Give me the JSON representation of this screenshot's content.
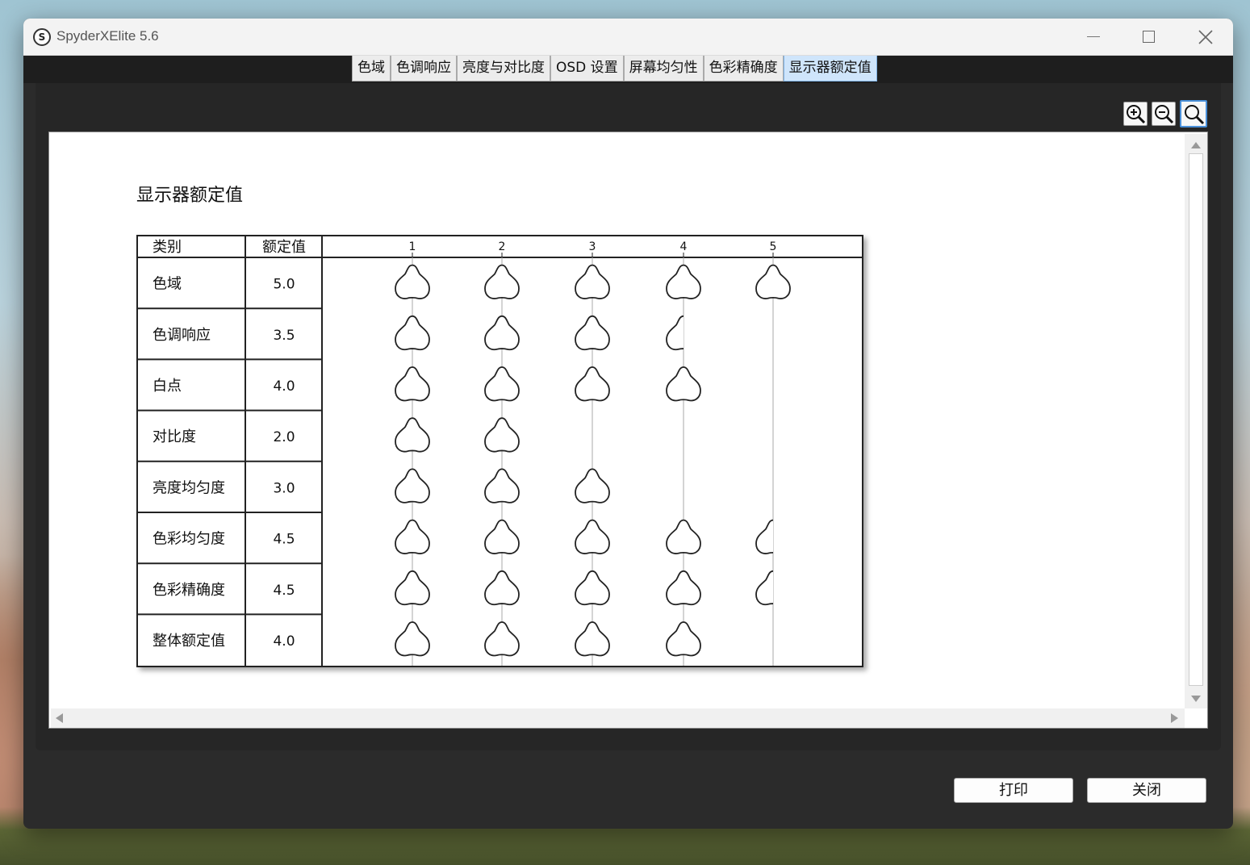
{
  "window": {
    "title": "SpyderXElite 5.6",
    "app_icon_letter": "S"
  },
  "tabs": [
    {
      "label": "色域",
      "active": false
    },
    {
      "label": "色调响应",
      "active": false
    },
    {
      "label": "亮度与对比度",
      "active": false
    },
    {
      "label": "OSD 设置",
      "active": false
    },
    {
      "label": "屏幕均匀性",
      "active": false
    },
    {
      "label": "色彩精确度",
      "active": false
    },
    {
      "label": "显示器额定值",
      "active": true
    }
  ],
  "report": {
    "title": "显示器额定值",
    "header": {
      "category": "类别",
      "rating": "额定值",
      "scale": [
        "1",
        "2",
        "3",
        "4",
        "5"
      ]
    },
    "rows": [
      {
        "category": "色域",
        "rating": "5.0",
        "value": 5.0
      },
      {
        "category": "色调响应",
        "rating": "3.5",
        "value": 3.5
      },
      {
        "category": "白点",
        "rating": "4.0",
        "value": 4.0
      },
      {
        "category": "对比度",
        "rating": "2.0",
        "value": 2.0
      },
      {
        "category": "亮度均匀度",
        "rating": "3.0",
        "value": 3.0
      },
      {
        "category": "色彩均匀度",
        "rating": "4.5",
        "value": 4.5
      },
      {
        "category": "色彩精确度",
        "rating": "4.5",
        "value": 4.5
      },
      {
        "category": "整体额定值",
        "rating": "4.0",
        "value": 4.0
      }
    ]
  },
  "buttons": {
    "print": "打印",
    "close": "关闭"
  },
  "colors": {
    "active_tab": "#cfe5fb",
    "window_bg": "#2b2b2b",
    "zoom_fit_border": "#4a90d9"
  }
}
